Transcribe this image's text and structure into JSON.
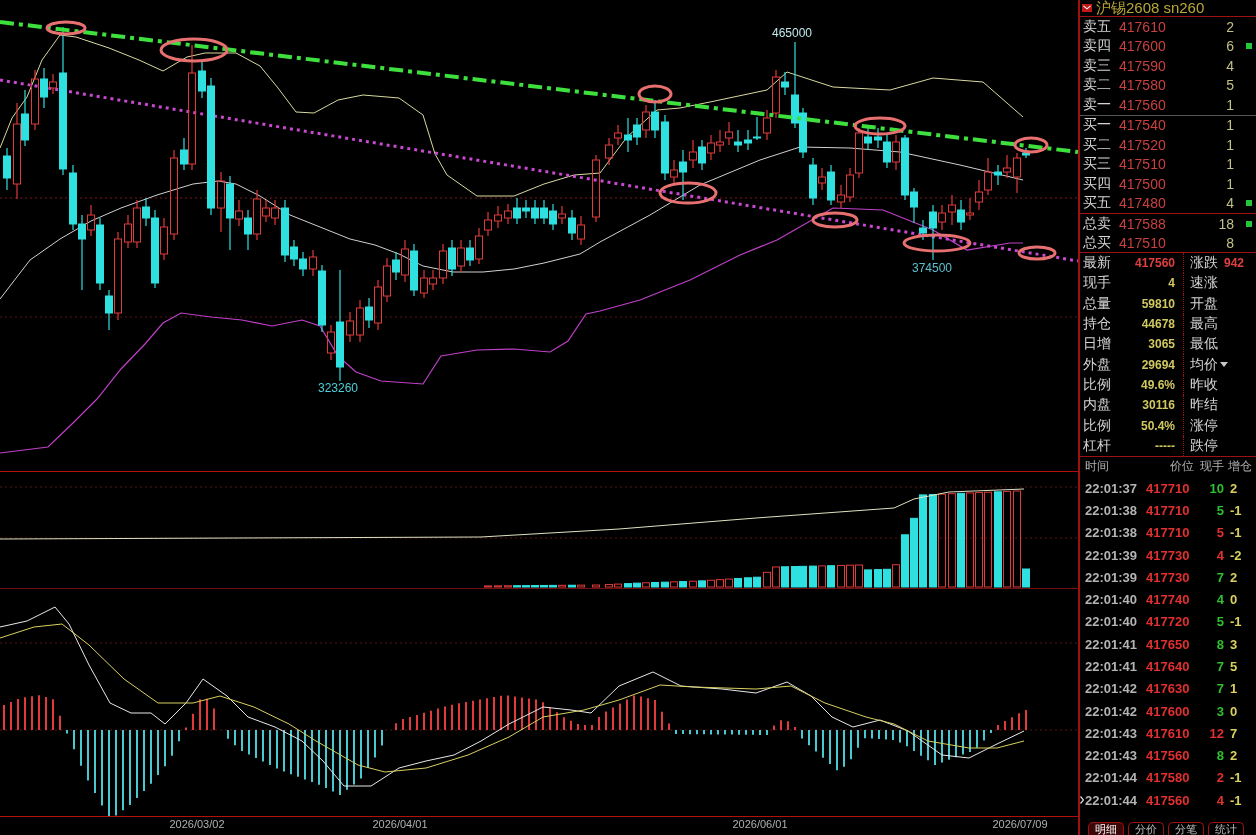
{
  "chart": {
    "price_labels": [
      "465000",
      "323260",
      "374500"
    ],
    "dates": [
      "2026/03/02",
      "2026/04/01",
      "2026/06/01",
      "2026/07/09"
    ]
  },
  "symbol": {
    "name": "沪锡2608",
    "code": "sn260"
  },
  "order_book": {
    "asks": [
      {
        "label": "卖五",
        "price": "417610",
        "volume": "2",
        "flag": false
      },
      {
        "label": "卖四",
        "price": "417600",
        "volume": "6",
        "flag": true
      },
      {
        "label": "卖三",
        "price": "417590",
        "volume": "4",
        "flag": false
      },
      {
        "label": "卖二",
        "price": "417580",
        "volume": "5",
        "flag": false
      },
      {
        "label": "卖一",
        "price": "417560",
        "volume": "1",
        "flag": false
      }
    ],
    "bids": [
      {
        "label": "买一",
        "price": "417540",
        "volume": "1",
        "flag": false
      },
      {
        "label": "买二",
        "price": "417520",
        "volume": "1",
        "flag": false
      },
      {
        "label": "买三",
        "price": "417510",
        "volume": "1",
        "flag": false
      },
      {
        "label": "买四",
        "price": "417500",
        "volume": "1",
        "flag": false
      },
      {
        "label": "买五",
        "price": "417480",
        "volume": "4",
        "flag": true
      }
    ],
    "totals": [
      {
        "label": "总卖",
        "price": "417588",
        "volume": "18",
        "flag": true
      },
      {
        "label": "总买",
        "price": "417510",
        "volume": "8",
        "flag": false
      }
    ]
  },
  "quote": {
    "left": [
      {
        "label": "最新",
        "value": "417560",
        "kind": "price"
      },
      {
        "label": "现手",
        "value": "4",
        "kind": "count"
      },
      {
        "label": "总量",
        "value": "59810",
        "kind": "count"
      },
      {
        "label": "持仓",
        "value": "44678",
        "kind": "count"
      },
      {
        "label": "日增",
        "value": "3065",
        "kind": "count"
      },
      {
        "label": "外盘",
        "value": "29694",
        "kind": "count"
      },
      {
        "label": "比例",
        "value": "49.6%",
        "kind": "count"
      },
      {
        "label": "内盘",
        "value": "30116",
        "kind": "count"
      },
      {
        "label": "比例",
        "value": "50.4%",
        "kind": "count"
      },
      {
        "label": "杠杆",
        "value": "-----",
        "kind": "count"
      }
    ],
    "right": [
      {
        "label": "涨跌",
        "value": "942",
        "dropdown": false
      },
      {
        "label": "速涨",
        "dropdown": false
      },
      {
        "label": "开盘",
        "dropdown": false
      },
      {
        "label": "最高",
        "dropdown": false
      },
      {
        "label": "最低",
        "dropdown": false
      },
      {
        "label": "均价",
        "dropdown": true
      },
      {
        "label": "昨收",
        "dropdown": false
      },
      {
        "label": "昨结",
        "dropdown": false
      },
      {
        "label": "涨停",
        "dropdown": false
      },
      {
        "label": "跌停",
        "dropdown": false
      }
    ]
  },
  "ticks": {
    "columns": [
      "时间",
      "价位",
      "现手",
      "增仓"
    ],
    "rows": [
      {
        "time": "22:01:37",
        "price": "417710",
        "volume": "10",
        "kind": "sell",
        "change": "2",
        "current": false
      },
      {
        "time": "22:01:38",
        "price": "417710",
        "volume": "5",
        "kind": "sell",
        "change": "-1",
        "current": false
      },
      {
        "time": "22:01:38",
        "price": "417710",
        "volume": "5",
        "kind": "buy",
        "change": "-1",
        "current": false
      },
      {
        "time": "22:01:39",
        "price": "417730",
        "volume": "4",
        "kind": "buy",
        "change": "-2",
        "current": false
      },
      {
        "time": "22:01:39",
        "price": "417730",
        "volume": "7",
        "kind": "sell",
        "change": "2",
        "current": false
      },
      {
        "time": "22:01:40",
        "price": "417740",
        "volume": "4",
        "kind": "sell",
        "change": "0",
        "current": false
      },
      {
        "time": "22:01:40",
        "price": "417720",
        "volume": "5",
        "kind": "sell",
        "change": "-1",
        "current": false
      },
      {
        "time": "22:01:41",
        "price": "417650",
        "volume": "8",
        "kind": "sell",
        "change": "3",
        "current": false
      },
      {
        "time": "22:01:41",
        "price": "417640",
        "volume": "7",
        "kind": "sell",
        "change": "5",
        "current": false
      },
      {
        "time": "22:01:42",
        "price": "417630",
        "volume": "7",
        "kind": "sell",
        "change": "1",
        "current": false
      },
      {
        "time": "22:01:42",
        "price": "417600",
        "volume": "3",
        "kind": "sell",
        "change": "0",
        "current": false
      },
      {
        "time": "22:01:43",
        "price": "417610",
        "volume": "12",
        "kind": "buy",
        "change": "7",
        "current": false
      },
      {
        "time": "22:01:43",
        "price": "417560",
        "volume": "8",
        "kind": "sell",
        "change": "2",
        "current": false
      },
      {
        "time": "22:01:44",
        "price": "417580",
        "volume": "2",
        "kind": "buy",
        "change": "-1",
        "current": false
      },
      {
        "time": "22:01:44",
        "price": "417560",
        "volume": "4",
        "kind": "buy",
        "change": "-1",
        "current": true
      }
    ]
  },
  "tabs": [
    {
      "label": "明细",
      "selected": true
    },
    {
      "label": "分价",
      "selected": false
    },
    {
      "label": "分笔",
      "selected": false
    },
    {
      "label": "统计",
      "selected": false
    }
  ]
}
